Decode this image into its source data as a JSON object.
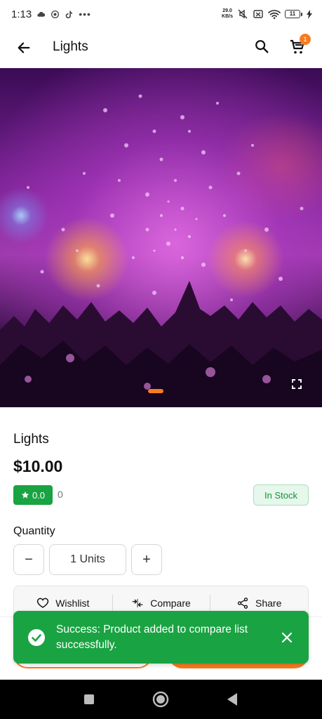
{
  "status_bar": {
    "time": "1:13",
    "net_speed_value": "29.0",
    "net_speed_unit": "KB/s",
    "battery": "11"
  },
  "app_bar": {
    "title": "Lights",
    "cart_count": "1"
  },
  "gallery": {
    "image_description_icon": "photo",
    "current_index": 1,
    "total": 1
  },
  "product": {
    "name": "Lights",
    "price": "$10.00",
    "rating": "0.0",
    "review_count": "0",
    "stock_status": "In Stock"
  },
  "quantity": {
    "label": "Quantity",
    "minus": "−",
    "value": "1 Units",
    "plus": "+"
  },
  "actions": {
    "wishlist": "Wishlist",
    "compare": "Compare",
    "share": "Share"
  },
  "toast": {
    "message": "Success: Product added to compare list successfully."
  },
  "colors": {
    "accent": "#f57c1f",
    "success": "#1aa342",
    "stock_bg": "#e6f7ec",
    "stock_text": "#17913b"
  }
}
